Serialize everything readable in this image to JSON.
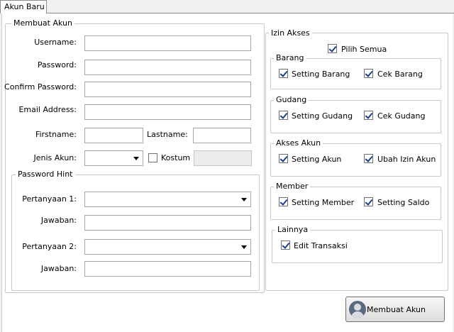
{
  "tab": {
    "label": "Akun Baru"
  },
  "account_group": {
    "legend": "Membuat Akun",
    "username_label": "Username:",
    "password_label": "Password:",
    "confirm_password_label": "Confirm Password:",
    "email_label": "Email Address:",
    "firstname_label": "Firstname:",
    "lastname_label": "Lastname:",
    "jenis_akun_label": "Jenis Akun:",
    "kostum_label": "Kostum",
    "username": "",
    "password": "",
    "confirm_password": "",
    "email": "",
    "firstname": "",
    "lastname": "",
    "jenis_akun": "",
    "kostum_checked": false
  },
  "password_hint": {
    "legend": "Password Hint",
    "q1_label": "Pertanyaan 1:",
    "a1_label": "Jawaban:",
    "q2_label": "Pertanyaan 2:",
    "a2_label": "Jawaban:",
    "q1": "",
    "a1": "",
    "q2": "",
    "a2": ""
  },
  "permissions": {
    "legend": "Izin Akses",
    "select_all": {
      "label": "Pilih Semua",
      "checked": true
    },
    "groups": [
      {
        "legend": "Barang",
        "items": [
          {
            "label": "Setting Barang",
            "checked": true
          },
          {
            "label": "Cek Barang",
            "checked": true
          }
        ]
      },
      {
        "legend": "Gudang",
        "items": [
          {
            "label": "Setting Gudang",
            "checked": true
          },
          {
            "label": "Cek Gudang",
            "checked": true
          }
        ]
      },
      {
        "legend": "Akses Akun",
        "items": [
          {
            "label": "Setting Akun",
            "checked": true
          },
          {
            "label": "Ubah Izin Akun",
            "checked": true
          }
        ]
      },
      {
        "legend": "Member",
        "items": [
          {
            "label": "Setting Member",
            "checked": true
          },
          {
            "label": "Setting Saldo",
            "checked": true
          }
        ]
      },
      {
        "legend": "Lainnya",
        "items": [
          {
            "label": "Edit Transaksi",
            "checked": true
          }
        ]
      }
    ]
  },
  "submit": {
    "label": "Membuat Akun",
    "icon": "user-icon"
  }
}
